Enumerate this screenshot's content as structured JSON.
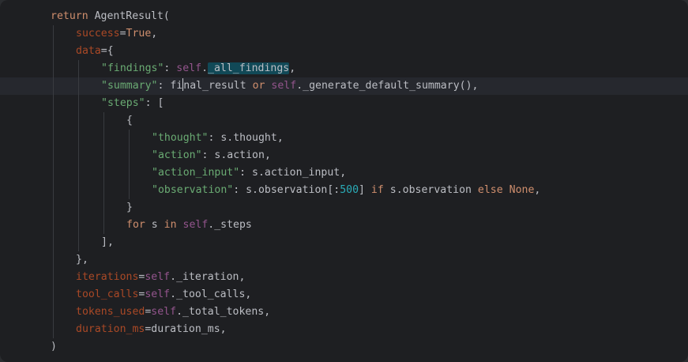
{
  "editor": {
    "language": "python",
    "lines": [
      {
        "indent": 0,
        "tokens": [
          {
            "t": "kw",
            "v": "return"
          },
          {
            "t": "ident",
            "v": " AgentResult("
          }
        ]
      },
      {
        "indent": 1,
        "tokens": [
          {
            "t": "param",
            "v": "success"
          },
          {
            "t": "punc",
            "v": "="
          },
          {
            "t": "kw",
            "v": "True"
          },
          {
            "t": "punc",
            "v": ","
          }
        ]
      },
      {
        "indent": 1,
        "tokens": [
          {
            "t": "param",
            "v": "data"
          },
          {
            "t": "punc",
            "v": "={"
          }
        ]
      },
      {
        "indent": 2,
        "tokens": [
          {
            "t": "str",
            "v": "\"findings\""
          },
          {
            "t": "punc",
            "v": ": "
          },
          {
            "t": "self",
            "v": "self"
          },
          {
            "t": "punc",
            "v": "."
          },
          {
            "t": "ident",
            "v": "_all_findings",
            "highlight": true
          },
          {
            "t": "punc",
            "v": ","
          }
        ]
      },
      {
        "indent": 2,
        "current": true,
        "tokens": [
          {
            "t": "str",
            "v": "\"summary\""
          },
          {
            "t": "punc",
            "v": ": "
          },
          {
            "t": "ident",
            "v": "fi"
          },
          {
            "t": "caret",
            "v": ""
          },
          {
            "t": "ident",
            "v": "nal_result"
          },
          {
            "t": "kw",
            "v": " or "
          },
          {
            "t": "self",
            "v": "self"
          },
          {
            "t": "punc",
            "v": "."
          },
          {
            "t": "ident",
            "v": "_generate_default_summary(),"
          }
        ]
      },
      {
        "indent": 2,
        "tokens": [
          {
            "t": "str",
            "v": "\"steps\""
          },
          {
            "t": "punc",
            "v": ": ["
          }
        ]
      },
      {
        "indent": 3,
        "tokens": [
          {
            "t": "punc",
            "v": "{"
          }
        ]
      },
      {
        "indent": 4,
        "tokens": [
          {
            "t": "str",
            "v": "\"thought\""
          },
          {
            "t": "punc",
            "v": ": "
          },
          {
            "t": "ident",
            "v": "s.thought,"
          }
        ]
      },
      {
        "indent": 4,
        "tokens": [
          {
            "t": "str",
            "v": "\"action\""
          },
          {
            "t": "punc",
            "v": ": "
          },
          {
            "t": "ident",
            "v": "s.action,"
          }
        ]
      },
      {
        "indent": 4,
        "tokens": [
          {
            "t": "str",
            "v": "\"action_input\""
          },
          {
            "t": "punc",
            "v": ": "
          },
          {
            "t": "ident",
            "v": "s.action_input,"
          }
        ]
      },
      {
        "indent": 4,
        "tokens": [
          {
            "t": "str",
            "v": "\"observation\""
          },
          {
            "t": "punc",
            "v": ": "
          },
          {
            "t": "ident",
            "v": "s.observation[:"
          },
          {
            "t": "num",
            "v": "500"
          },
          {
            "t": "punc",
            "v": "] "
          },
          {
            "t": "kw",
            "v": "if"
          },
          {
            "t": "ident",
            "v": " s.observation "
          },
          {
            "t": "kw",
            "v": "else"
          },
          {
            "t": "ident",
            "v": " "
          },
          {
            "t": "kw",
            "v": "None"
          },
          {
            "t": "punc",
            "v": ","
          }
        ]
      },
      {
        "indent": 3,
        "tokens": [
          {
            "t": "punc",
            "v": "}"
          }
        ]
      },
      {
        "indent": 3,
        "tokens": [
          {
            "t": "kw",
            "v": "for"
          },
          {
            "t": "ident",
            "v": " s "
          },
          {
            "t": "kw",
            "v": "in"
          },
          {
            "t": "ident",
            "v": " "
          },
          {
            "t": "self",
            "v": "self"
          },
          {
            "t": "ident",
            "v": "._steps"
          }
        ]
      },
      {
        "indent": 2,
        "tokens": [
          {
            "t": "punc",
            "v": "],"
          }
        ]
      },
      {
        "indent": 1,
        "tokens": [
          {
            "t": "punc",
            "v": "},"
          }
        ]
      },
      {
        "indent": 1,
        "tokens": [
          {
            "t": "param",
            "v": "iterations"
          },
          {
            "t": "punc",
            "v": "="
          },
          {
            "t": "self",
            "v": "self"
          },
          {
            "t": "ident",
            "v": "._iteration,"
          }
        ]
      },
      {
        "indent": 1,
        "tokens": [
          {
            "t": "param",
            "v": "tool_calls"
          },
          {
            "t": "punc",
            "v": "="
          },
          {
            "t": "self",
            "v": "self"
          },
          {
            "t": "ident",
            "v": "._tool_calls,"
          }
        ]
      },
      {
        "indent": 1,
        "tokens": [
          {
            "t": "param",
            "v": "tokens_used"
          },
          {
            "t": "punc",
            "v": "="
          },
          {
            "t": "self",
            "v": "self"
          },
          {
            "t": "ident",
            "v": "._total_tokens,"
          }
        ]
      },
      {
        "indent": 1,
        "tokens": [
          {
            "t": "param",
            "v": "duration_ms"
          },
          {
            "t": "punc",
            "v": "="
          },
          {
            "t": "ident",
            "v": "duration_ms,"
          }
        ]
      },
      {
        "indent": 0,
        "tokens": [
          {
            "t": "punc",
            "v": ")"
          }
        ]
      }
    ]
  }
}
